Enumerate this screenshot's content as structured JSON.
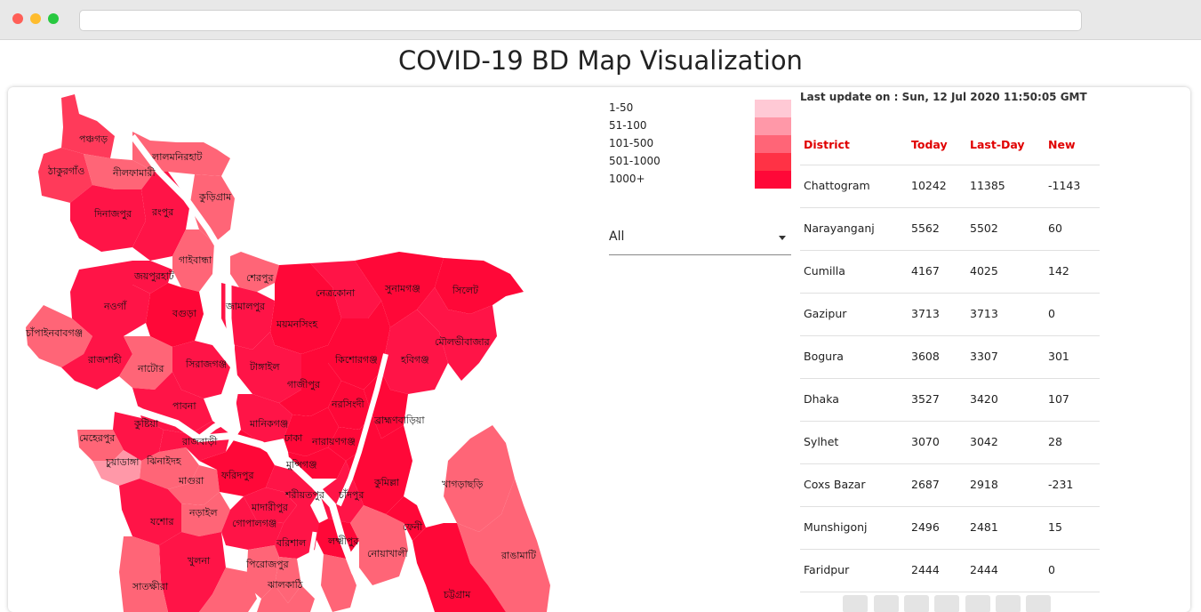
{
  "page": {
    "title": "COVID-19 BD Map Visualization"
  },
  "legend": [
    {
      "label": "1-50",
      "color": "#ffc9d5"
    },
    {
      "label": "51-100",
      "color": "#ff98a8"
    },
    {
      "label": "101-500",
      "color": "#ff6577"
    },
    {
      "label": "501-1000",
      "color": "#ff3245"
    },
    {
      "label": "1000+",
      "color": "#ff0838"
    }
  ],
  "filter": {
    "selected": "All"
  },
  "update": {
    "text": "Last update on : Sun, 12 Jul 2020 11:50:05 GMT"
  },
  "table": {
    "headers": [
      "District",
      "Today",
      "Last-Day",
      "New"
    ],
    "rows": [
      [
        "Chattogram",
        "10242",
        "11385",
        "-1143"
      ],
      [
        "Narayanganj",
        "5562",
        "5502",
        "60"
      ],
      [
        "Cumilla",
        "4167",
        "4025",
        "142"
      ],
      [
        "Gazipur",
        "3713",
        "3713",
        "0"
      ],
      [
        "Bogura",
        "3608",
        "3307",
        "301"
      ],
      [
        "Dhaka",
        "3527",
        "3420",
        "107"
      ],
      [
        "Sylhet",
        "3070",
        "3042",
        "28"
      ],
      [
        "Coxs Bazar",
        "2687",
        "2918",
        "-231"
      ],
      [
        "Munshigonj",
        "2496",
        "2481",
        "15"
      ],
      [
        "Faridpur",
        "2444",
        "2444",
        "0"
      ]
    ]
  },
  "map_labels": [
    "পঞ্চগড়",
    "ঠাকুরগাঁও",
    "নীলফামারী",
    "লালমনিরহাট",
    "কুড়িগ্রাম",
    "দিনাজপুর",
    "রংপুর",
    "গাইবান্ধা",
    "জয়পুরহাট",
    "নওগাঁ",
    "বগুড়া",
    "চাঁপাইনবাবগঞ্জ",
    "রাজশাহী",
    "নাটোর",
    "সিরাজগঞ্জ",
    "পাবনা",
    "কুষ্টিয়া",
    "মেহেরপুর",
    "চুয়াডাঙ্গা",
    "ঝিনাইদহ",
    "রাজবাড়ী",
    "মাগুরা",
    "যশোর",
    "নড়াইল",
    "খুলনা",
    "সাতক্ষীরা",
    "শেরপুর",
    "জামালপুর",
    "ময়মনসিংহ",
    "নেত্রকোনা",
    "সুনামগঞ্জ",
    "সিলেট",
    "মৌলভীবাজার",
    "হবিগঞ্জ",
    "কিশোরগঞ্জ",
    "টাঙ্গাইল",
    "গাজীপুর",
    "নরসিংদী",
    "মানিকগঞ্জ",
    "ঢাকা",
    "নারায়ণগঞ্জ",
    "মুন্সিগঞ্জ",
    "ফরিদপুর",
    "মাদারীপুর",
    "শরীয়তপুর",
    "গোপালগঞ্জ",
    "চাঁদপুর",
    "কুমিল্লা",
    "ব্রাহ্মণবাড়িয়া",
    "লক্ষ্মীপুর",
    "নোয়াখালী",
    "ফেনী",
    "বরিশাল",
    "পিরোজপুর",
    "ঝালকাঠি",
    "খাগড়াছড়ি",
    "রাঙামাটি",
    "চট্টগ্রাম"
  ]
}
